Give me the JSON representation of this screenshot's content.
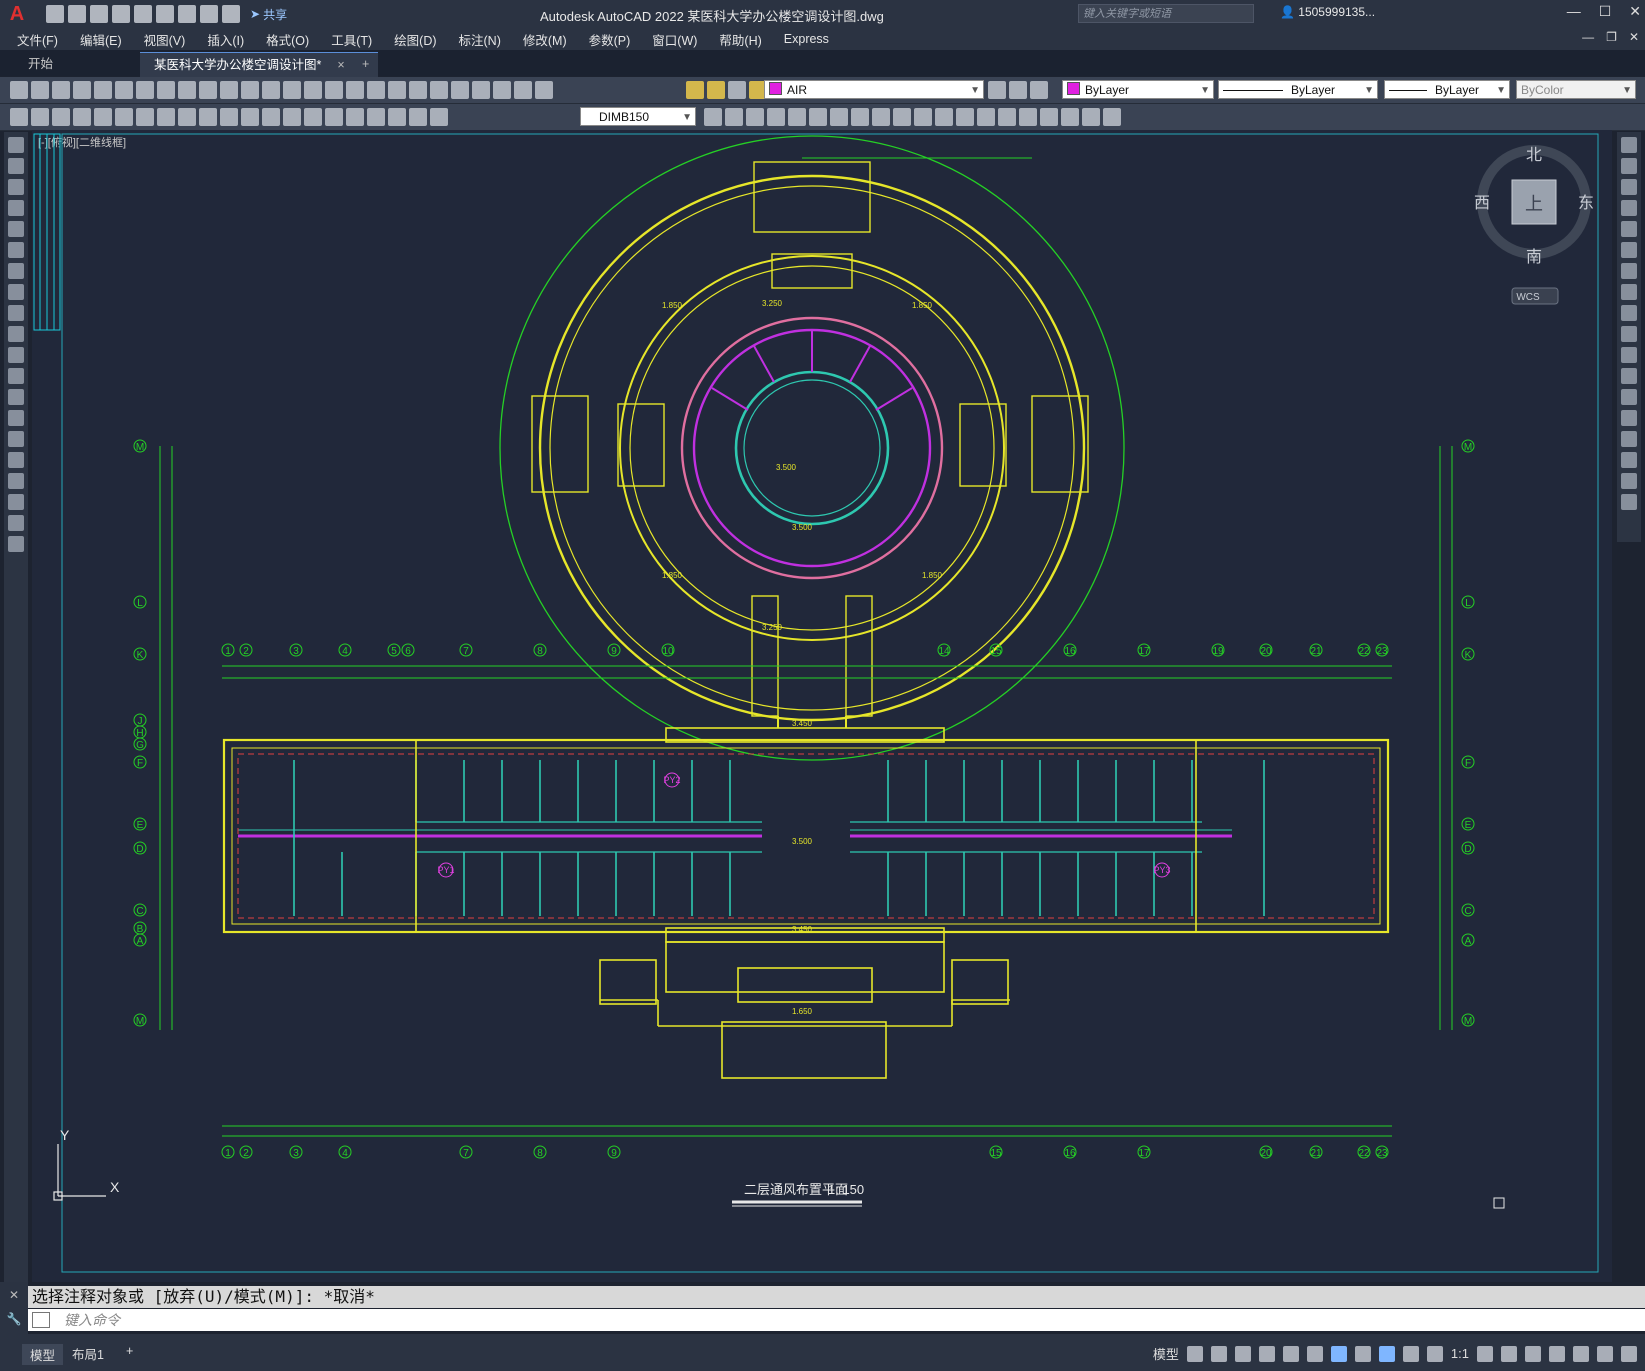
{
  "app": {
    "title": "Autodesk AutoCAD 2022    某医科大学办公楼空调设计图.dwg",
    "logo": "A",
    "share_label": "共享",
    "search_placeholder": "键入关键字或短语",
    "user": "1505999135..."
  },
  "menu": [
    "文件(F)",
    "编辑(E)",
    "视图(V)",
    "插入(I)",
    "格式(O)",
    "工具(T)",
    "绘图(D)",
    "标注(N)",
    "修改(M)",
    "参数(P)",
    "窗口(W)",
    "帮助(H)",
    "Express"
  ],
  "tabs": {
    "start": "开始",
    "doc": "某医科大学办公楼空调设计图*",
    "close": "×",
    "add": "+"
  },
  "toolbar": {
    "layer": "AIR",
    "layer_color": "#e020e0",
    "color": "ByLayer",
    "linetype": "ByLayer",
    "lineweight": "ByLayer",
    "plotstyle": "ByColor",
    "dimstyle": "DIMB150"
  },
  "viewport": {
    "label": "[-][俯视][二维线框]"
  },
  "viewcube": {
    "north": "北",
    "south": "南",
    "east": "东",
    "west": "西",
    "top": "上",
    "wcs": "WCS"
  },
  "drawing": {
    "title": "二层通风布置平面",
    "scale": "1: 150",
    "axis_y": "Y",
    "axis_x": "X",
    "row_labels": [
      "M",
      "L",
      "K",
      "J",
      "H",
      "G",
      "F",
      "E",
      "D",
      "C",
      "B",
      "A"
    ],
    "col_labels": [
      "1",
      "2",
      "3",
      "4",
      "5",
      "6",
      "7",
      "8",
      "9",
      "10",
      "11",
      "12",
      "13",
      "14",
      "15",
      "16",
      "17",
      "18",
      "19",
      "20",
      "21",
      "22",
      "23"
    ],
    "elevations": [
      "3.250",
      "1.850",
      "3.350",
      "3.500",
      "3.450",
      "1.650"
    ],
    "equipment_tags": [
      "PY2",
      "PY1",
      "PY3"
    ]
  },
  "command": {
    "history": "选择注释对象或 [放弃(U)/模式(M)]: *取消*",
    "placeholder": "键入命令"
  },
  "status": {
    "tabs": [
      "模型",
      "布局1",
      "+"
    ],
    "model_label": "模型",
    "anno_scale": "1:1"
  }
}
